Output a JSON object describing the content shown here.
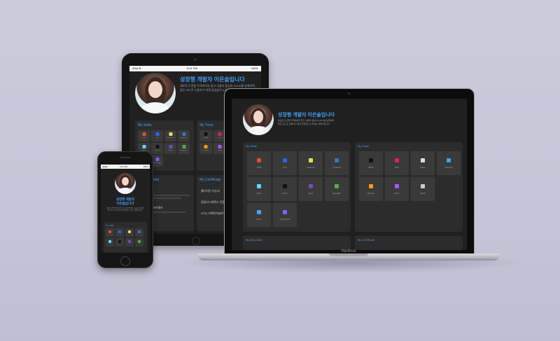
{
  "hero": {
    "title": "성장형 개발자 이은솔입니다",
    "phone_title_1": "성장형 개발자",
    "phone_title_2": "이은솔입니다",
    "desc_1": "새로운 도전을 두려워하지 않고 사용자 중심의 UI/UX를 설계하며,",
    "desc_2": "좋은 코드로 소통하기 위해 끊임없이 노력하는 개발자입니다."
  },
  "sections": {
    "skills": "My Skills",
    "tools": "My Tools",
    "education": "My Education",
    "certificate": "My Certificate"
  },
  "skills": [
    {
      "label": "HTML",
      "color": "#e44d26"
    },
    {
      "label": "CSS",
      "color": "#2965f1"
    },
    {
      "label": "JavaScript",
      "color": "#f0db4f"
    },
    {
      "label": "TypeScript",
      "color": "#3178c6"
    },
    {
      "label": "React",
      "color": "#61dafb"
    },
    {
      "label": "Next.js",
      "color": "#111111"
    },
    {
      "label": "Redux",
      "color": "#764abc"
    },
    {
      "label": "MongoDB",
      "color": "#4db33d"
    },
    {
      "label": "Flutter",
      "color": "#42a5f5"
    },
    {
      "label": "Visual Studio",
      "color": "#7b61ff"
    }
  ],
  "tools": [
    {
      "label": "GitHub",
      "color": "#111111"
    },
    {
      "label": "Slack",
      "color": "#e01e5a"
    },
    {
      "label": "Notion",
      "color": "#dddddd"
    },
    {
      "label": "Photoshop",
      "color": "#31a8ff"
    },
    {
      "label": "Illustrator",
      "color": "#ff9a00"
    },
    {
      "label": "Figma",
      "color": "#a259ff"
    },
    {
      "label": "GitHub",
      "color": "#cccccc"
    }
  ],
  "ipad": {
    "status_left": "iPad ≋",
    "status_time": "9:41 PM",
    "status_right": "100%",
    "edu_1": "부천대학교",
    "edu_2": "그린컴퓨터아카데미",
    "cert_1": "웹디자인 기능사",
    "cert_2": "컴퓨터그래픽스 운용기능사",
    "cert_3": "GTQ 그래픽기술자격"
  },
  "iphone": {
    "status_left": "●●●●○",
    "status_time": "9:41 AM",
    "status_right": "100%"
  },
  "mac": {
    "brand": "MacBook"
  }
}
